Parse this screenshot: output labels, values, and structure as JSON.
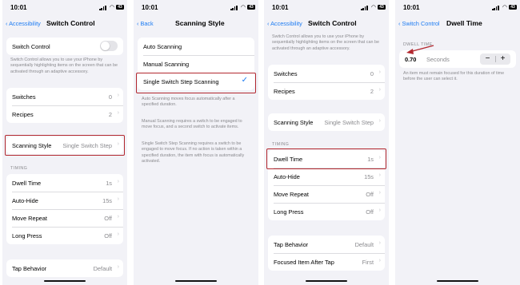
{
  "colors": {
    "accent": "#1e7cf2",
    "highlight": "#b3282f",
    "background": "#f2f2f7"
  },
  "icons": {
    "back": "chevron-left-icon",
    "row": "chevron-right-icon",
    "selected": "checkmark-icon",
    "minus": "minus-icon",
    "plus": "plus-icon"
  },
  "status": {
    "time": "10:01",
    "battery": "43"
  },
  "panel1": {
    "back_label": "Accessibility",
    "title": "Switch Control",
    "switch_control_label": "Switch Control",
    "switch_control_note": "Switch Control allows you to use your iPhone by sequentially highlighting items on the screen that can be activated through an adaptive accessory.",
    "switches": {
      "label": "Switches",
      "value": "0"
    },
    "recipes": {
      "label": "Recipes",
      "value": "2"
    },
    "scanning_style": {
      "label": "Scanning Style",
      "value": "Single Switch Step"
    },
    "timing_header": "TIMING",
    "dwell_time": {
      "label": "Dwell Time",
      "value": "1s"
    },
    "auto_hide": {
      "label": "Auto-Hide",
      "value": "15s"
    },
    "move_repeat": {
      "label": "Move Repeat",
      "value": "Off"
    },
    "long_press": {
      "label": "Long Press",
      "value": "Off"
    },
    "tap_behavior": {
      "label": "Tap Behavior",
      "value": "Default"
    }
  },
  "panel2": {
    "back_label": "Back",
    "title": "Scanning Style",
    "options": [
      "Auto Scanning",
      "Manual Scanning",
      "Single Switch Step Scanning"
    ],
    "selected_index": 2,
    "note_auto": "Auto Scanning moves focus automatically after a specified duration.",
    "note_manual": "Manual Scanning requires a switch to be engaged to move focus, and a second switch to activate items.",
    "note_single": "Single Switch Step Scanning requires a switch to be engaged to move focus. If no action is taken within a specified duration, the item with focus is automatically activated."
  },
  "panel3": {
    "back_label": "Accessibility",
    "title": "Switch Control",
    "top_note": "Switch Control allows you to use your iPhone by sequentially highlighting items on the screen that can be activated through an adaptive accessory.",
    "switches": {
      "label": "Switches",
      "value": "0"
    },
    "recipes": {
      "label": "Recipes",
      "value": "2"
    },
    "scanning_style": {
      "label": "Scanning Style",
      "value": "Single Switch Step"
    },
    "timing_header": "TIMING",
    "dwell_time": {
      "label": "Dwell Time",
      "value": "1s"
    },
    "auto_hide": {
      "label": "Auto-Hide",
      "value": "15s"
    },
    "move_repeat": {
      "label": "Move Repeat",
      "value": "Off"
    },
    "long_press": {
      "label": "Long Press",
      "value": "Off"
    },
    "tap_behavior": {
      "label": "Tap Behavior",
      "value": "Default"
    },
    "focused_item_after_tap": {
      "label": "Focused Item After Tap",
      "value": "First"
    }
  },
  "panel4": {
    "back_label": "Switch Control",
    "title": "Dwell Time",
    "section_header": "DWELL TIME",
    "value": "0.70",
    "unit": "Seconds",
    "minus": "−",
    "plus": "+",
    "note": "An item must remain focused for this duration of time before the user can select it."
  }
}
